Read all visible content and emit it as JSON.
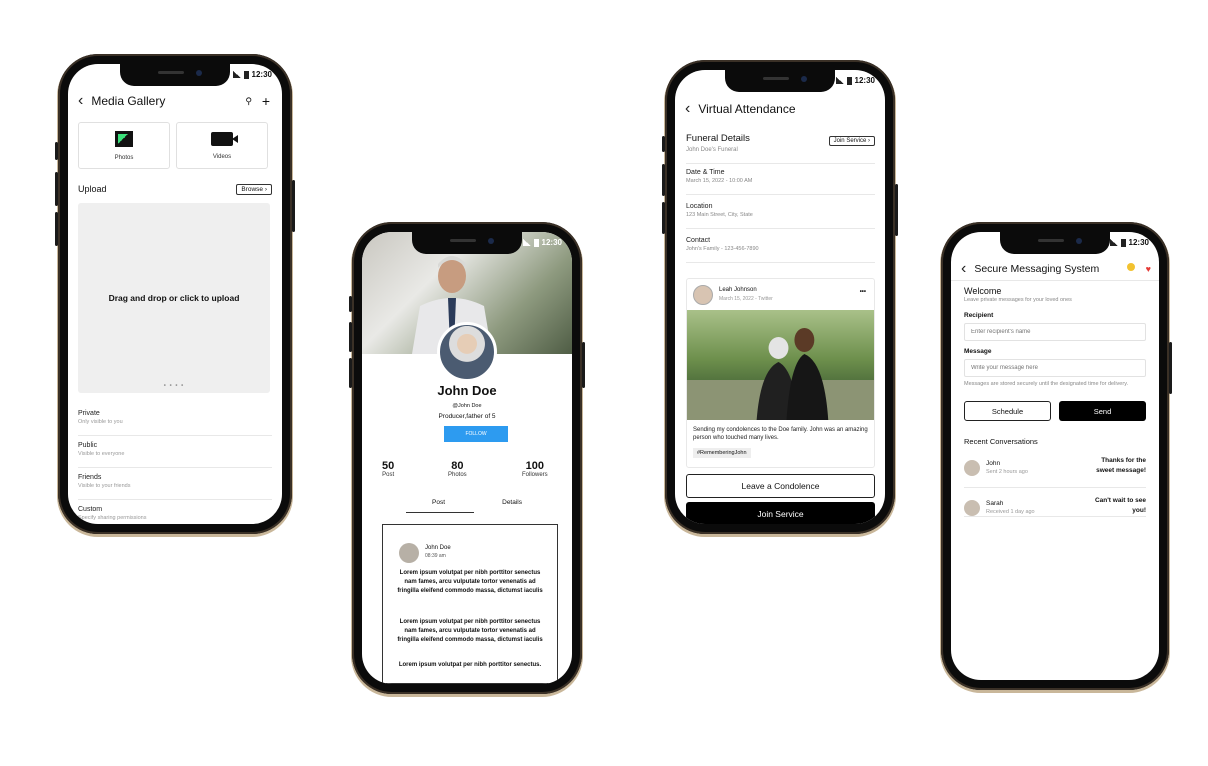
{
  "status_time": "12:30",
  "gallery": {
    "title": "Media Gallery",
    "tiles": [
      {
        "label": "Photos"
      },
      {
        "label": "Videos"
      }
    ],
    "upload_heading": "Upload",
    "browse_label": "Browse",
    "dropzone_text": "Drag and drop or click to upload",
    "dropzone_dots": "• • • •",
    "privacy_options": [
      {
        "label": "Private",
        "sub": "Only visible to you"
      },
      {
        "label": "Public",
        "sub": "Visible to everyone"
      },
      {
        "label": "Friends",
        "sub": "Visible to your friends"
      },
      {
        "label": "Custom",
        "sub": "Specify sharing permissions"
      }
    ]
  },
  "profile": {
    "name": "John Doe",
    "handle": "@John Doe",
    "bio": "Producer,father of 5",
    "follow_label": "FOLLOW",
    "stats": [
      {
        "value": "50",
        "label": "Post"
      },
      {
        "value": "80",
        "label": "Photos"
      },
      {
        "value": "100",
        "label": "Followers"
      }
    ],
    "tabs": [
      "Post",
      "Details"
    ],
    "post": {
      "author": "John Doe",
      "time": "08:39 am",
      "para1": "Lorem ipsum volutpat per nibh porttitor senectus nam fames, arcu vulputate tortor venenatis ad fringilla eleifend commodo massa, dictumst iaculis",
      "para2": "Lorem ipsum volutpat per nibh porttitor senectus nam fames, arcu vulputate tortor venenatis ad fringilla eleifend commodo massa, dictumst iaculis",
      "para3": "Lorem ipsum volutpat per nibh porttitor senectus."
    }
  },
  "attendance": {
    "title": "Virtual Attendance",
    "details_heading": "Funeral Details",
    "details_sub": "John Doe's Funeral",
    "join_small": "Join Service",
    "rows": [
      {
        "label": "Date & Time",
        "value": "March 15, 2022 - 10:00 AM"
      },
      {
        "label": "Location",
        "value": "123 Main Street, City, State"
      },
      {
        "label": "Contact",
        "value": "John's Family - 123-456-7890"
      }
    ],
    "card": {
      "author": "Leah Johnson",
      "meta": "March 15, 2022 - Twitter",
      "more": "•••",
      "text": "Sending my condolences to the Doe family. John was an amazing person who touched many lives.",
      "tag": "#RememberingJohn"
    },
    "condolence_label": "Leave a Condolence",
    "join_label": "Join Service"
  },
  "messaging": {
    "title": "Secure Messaging System",
    "welcome": "Welcome",
    "welcome_sub": "Leave private messages for your loved ones",
    "recipient_label": "Recipient",
    "recipient_placeholder": "Enter recipient's name",
    "message_label": "Message",
    "message_placeholder": "Write your message here",
    "note": "Messages are stored securely until the designated time for delivery.",
    "schedule_label": "Schedule",
    "send_label": "Send",
    "recent_heading": "Recent Conversations",
    "conversations": [
      {
        "name": "John",
        "time": "Sent 2 hours ago",
        "message": "Thanks for the sweet message!"
      },
      {
        "name": "Sarah",
        "time": "Received 1 day ago",
        "message": "Can't wait to see you!"
      }
    ],
    "colors": {
      "heart": "#e53935",
      "emoji": "#f2c230"
    }
  },
  "colors": {
    "follow": "#2d9bf0",
    "dark_button": "#000000"
  }
}
